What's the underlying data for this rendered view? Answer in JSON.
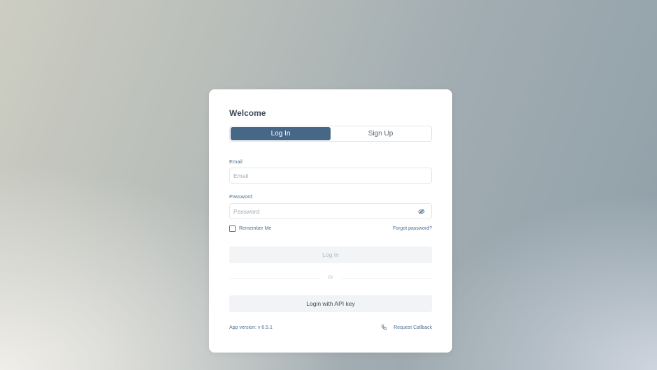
{
  "login_card": {
    "title": "Welcome",
    "tabs": [
      {
        "label": "Log In",
        "active": true
      },
      {
        "label": "Sign Up",
        "active": false
      }
    ],
    "email": {
      "label": "Email",
      "placeholder": "Email",
      "value": ""
    },
    "password": {
      "label": "Password",
      "placeholder": "Password",
      "value": "",
      "toggle_icon": "eye-off-icon"
    },
    "remember_me": {
      "label": "Remember Me",
      "checked": false
    },
    "forgot_password": "Forgot password?",
    "submit_label": "Log In",
    "divider_label": "Or",
    "api_key_label": "Login with API key",
    "version": "App version: v 6.5.1",
    "callback": {
      "label": "Request Callback",
      "icon": "phone-icon"
    }
  },
  "colors": {
    "accent": "#476787",
    "link": "#4d6f93",
    "text": "#3f4a5a"
  }
}
